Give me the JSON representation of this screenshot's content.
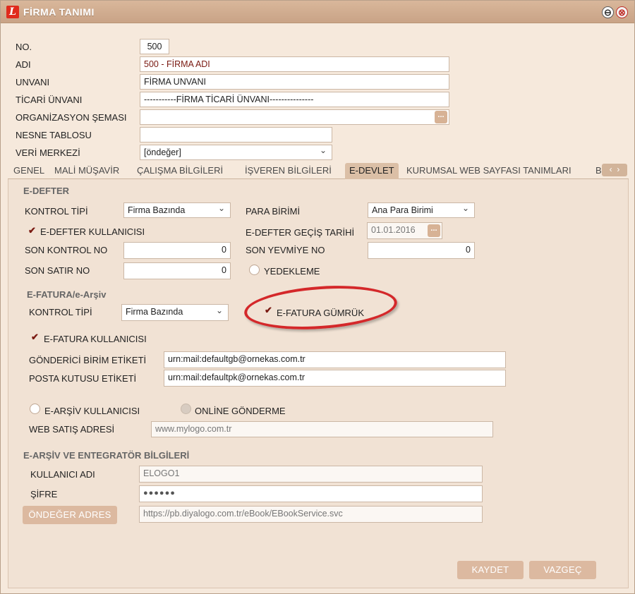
{
  "window": {
    "title": "FİRMA TANIMI",
    "logo_letter": "L",
    "minimize": "⊖",
    "close": "⊗"
  },
  "header_form": {
    "no_label": "NO.",
    "no_value": "500",
    "adi_label": "ADI",
    "adi_value": "500 - FİRMA ADI",
    "unvani_label": "UNVANI",
    "unvani_value": "FİRMA UNVANI",
    "ticari_label": "TİCARİ ÜNVANI",
    "ticari_value": "-----------FİRMA TİCARİ ÜNVANI---------------",
    "org_label": "ORGANİZASYON ŞEMASI",
    "org_value": "",
    "nesne_label": "NESNE TABLOSU",
    "nesne_value": "",
    "veri_label": "VERİ MERKEZİ",
    "veri_value": "[öndeğer]"
  },
  "tabs": [
    {
      "label": "GENEL"
    },
    {
      "label": "MALİ MÜŞAVİR"
    },
    {
      "label": "ÇALIŞMA BİLGİLERİ"
    },
    {
      "label": "İŞVEREN BİLGİLERİ"
    },
    {
      "label": "E-DEVLET",
      "active": true
    },
    {
      "label": "KURUMSAL WEB SAYFASI TANIMLARI"
    },
    {
      "label": "B"
    }
  ],
  "tab_scroll": {
    "prev": "‹",
    "next": "›"
  },
  "edefter": {
    "section_title": "E-DEFTER",
    "kontrol_label": "KONTROL TİPİ",
    "kontrol_value": "Firma Bazında",
    "para_label": "PARA BİRİMİ",
    "para_value": "Ana Para Birimi",
    "kullanici_label": "E-DEFTER KULLANICISI",
    "kullanici_checked": true,
    "gecis_label": "E-DEFTER GEÇİŞ TARİHİ",
    "gecis_value": "01.01.2016",
    "son_kontrol_label": "SON KONTROL NO",
    "son_kontrol_value": "0",
    "son_yevmiye_label": "SON YEVMİYE NO",
    "son_yevmiye_value": "0",
    "son_satir_label": "SON SATIR NO",
    "son_satir_value": "0",
    "yedekleme_label": "YEDEKLEME",
    "yedekleme_checked": false
  },
  "efatura": {
    "section_title": "E-FATURA/e-Arşiv",
    "kontrol_label": "KONTROL TİPİ",
    "kontrol_value": "Firma Bazında",
    "gumruk_label": "E-FATURA GÜMRÜK",
    "gumruk_checked": true,
    "kullanici_label": "E-FATURA KULLANICISI",
    "kullanici_checked": true,
    "gonderici_label": "GÖNDERİCİ BİRİM ETİKETİ",
    "gonderici_value": "urn:mail:defaultgb@ornekas.com.tr",
    "posta_label": "POSTA KUTUSU ETİKETİ",
    "posta_value": "urn:mail:defaultpk@ornekas.com.tr",
    "earsiv_label": "E-ARŞİV KULLANICISI",
    "earsiv_checked": false,
    "online_label": "ONLİNE GÖNDERME",
    "online_checked": false,
    "web_label": "WEB SATIŞ ADRESİ",
    "web_value": "www.mylogo.com.tr"
  },
  "earsiv_entegrator": {
    "section_title": "E-ARŞİV VE ENTEGRATÖR BİLGİLERİ",
    "kullanici_label": "KULLANICI ADI",
    "kullanici_value": "ELOGO1",
    "sifre_label": "ŞİFRE",
    "sifre_value": "●●●●●●",
    "ondeger_button": "ÖNDEĞER ADRES",
    "adres_value": "https://pb.diyalogo.com.tr/eBook/EBookService.svc"
  },
  "footer": {
    "kaydet": "KAYDET",
    "vazgec": "VAZGEÇ"
  },
  "glyphs": {
    "check": "✔",
    "dropdown": "⌄",
    "dots": "..."
  },
  "colors": {
    "accent_red": "#d4282a",
    "titlebar": "#c9a386",
    "button": "#dcb9a0"
  }
}
